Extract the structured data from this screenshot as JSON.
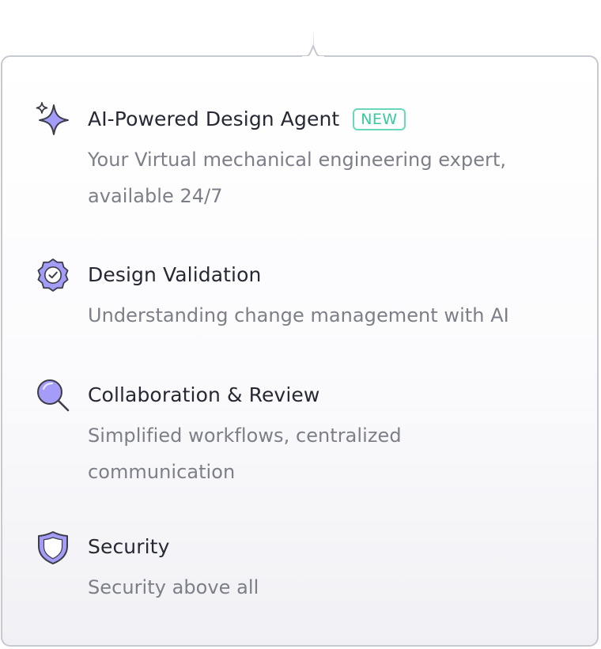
{
  "menu": {
    "items": [
      {
        "title": "AI-Powered Design Agent",
        "badge": "NEW",
        "description_lines": [
          "Your Virtual mechanical engineering expert,",
          "available 24/7"
        ],
        "icon": "sparkle-icon"
      },
      {
        "title": "Design Validation",
        "description_lines": [
          "Understanding change management with AI"
        ],
        "icon": "verified-badge-icon"
      },
      {
        "title": "Collaboration & Review",
        "description_lines": [
          "Simplified workflows, centralized",
          "communication"
        ],
        "icon": "magnifying-glass-icon"
      },
      {
        "title": "Security",
        "description_lines": [
          "Security above all"
        ],
        "icon": "shield-icon"
      }
    ]
  },
  "colors": {
    "icon_fill": "#a49cf7",
    "icon_outline": "#3c3d48",
    "new_badge": "#38c89f",
    "title": "#262833",
    "description": "#7d7f88",
    "panel_border": "#c7c9d0"
  }
}
